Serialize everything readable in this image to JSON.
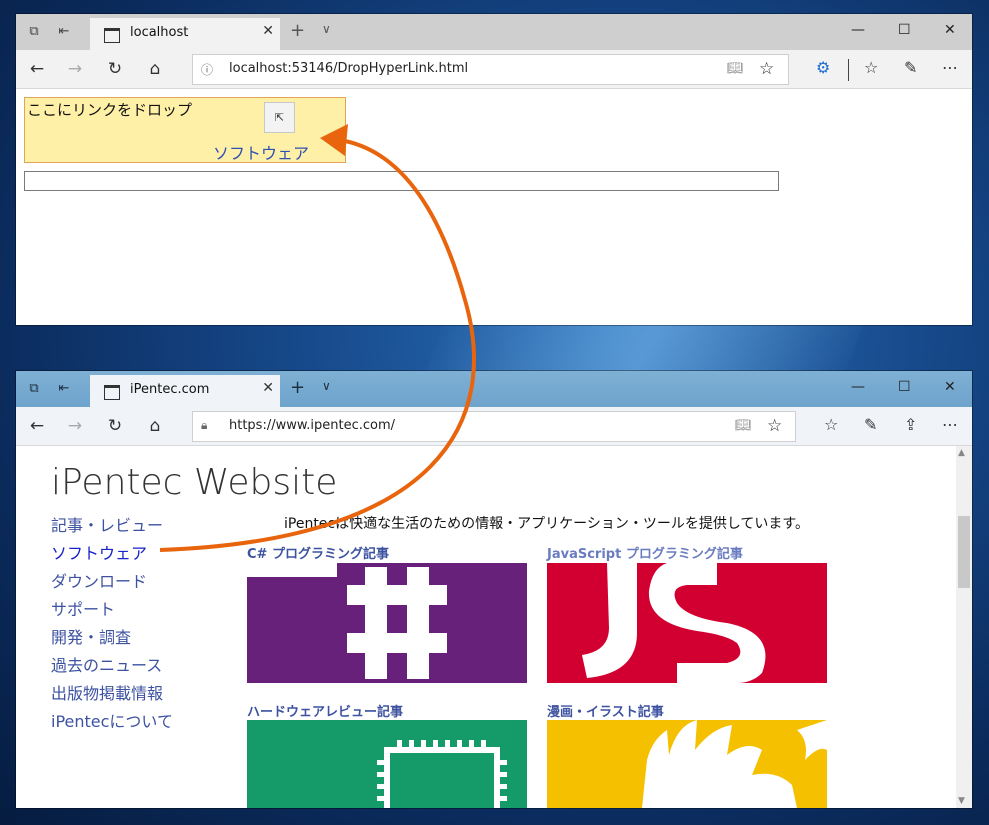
{
  "window1": {
    "tab_title": "localhost",
    "url": "localhost:53146/DropHyperLink.html",
    "drop_label": "ここにリンクをドロップ",
    "dropped_link_text": "ソフトウェア",
    "text_field_value": ""
  },
  "window2": {
    "tab_title": "iPentec.com",
    "url": "https://www.ipentec.com/",
    "site_title": "iPentec Website",
    "tagline": "iPentecは快適な生活のための情報・アプリケーション・ツールを提供しています。",
    "menu": [
      {
        "label": "記事・レビュー",
        "active": false
      },
      {
        "label": "ソフトウェア",
        "active": true
      },
      {
        "label": "ダウンロード",
        "active": false
      },
      {
        "label": "サポート",
        "active": false
      },
      {
        "label": "開発・調査",
        "active": false
      },
      {
        "label": "過去のニュース",
        "active": false
      },
      {
        "label": "出版物掲載情報",
        "active": false
      },
      {
        "label": "iPentecについて",
        "active": false
      }
    ],
    "categories": {
      "csharp": {
        "title": "C# プログラミング記事",
        "color": "#68217a",
        "logo": "C#"
      },
      "javascript": {
        "title": "JavaScript プログラミング記事",
        "color": "#d20031",
        "logo": "JS"
      },
      "hardware": {
        "title": "ハードウェアレビュー記事",
        "color": "#159a6a"
      },
      "illustration": {
        "title": "漫画・イラスト記事",
        "color": "#f5c000"
      }
    }
  },
  "icons": {
    "back": "arrow-left-icon",
    "forward": "arrow-right-icon",
    "refresh": "refresh-icon",
    "home": "home-icon",
    "favorite": "star-icon"
  },
  "colors": {
    "drag_arrow": "#e8650e",
    "link": "#3d52a0",
    "drop_zone_bg": "#fff0a8"
  }
}
